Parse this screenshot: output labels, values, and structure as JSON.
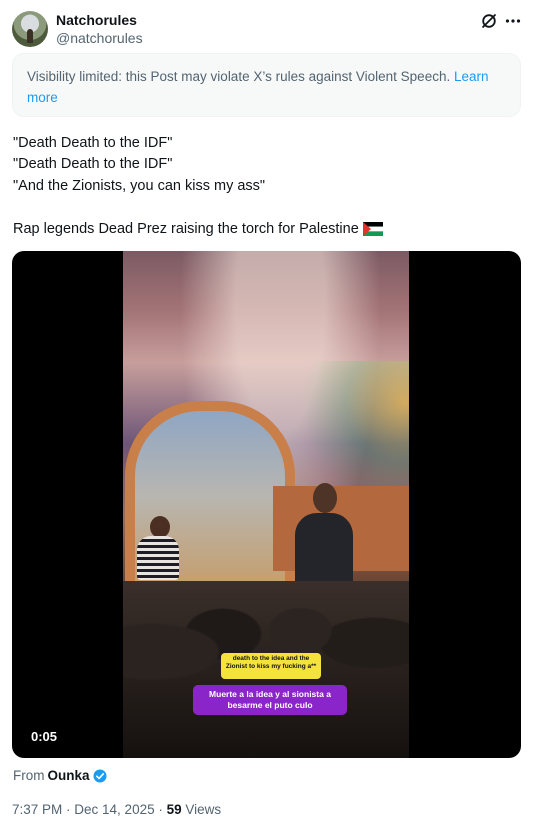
{
  "author": {
    "display_name": "Natchorules",
    "handle": "@natchorules"
  },
  "notice": {
    "text": "Visibility limited: this Post may violate X’s rules against Violent Speech. ",
    "link": "Learn more"
  },
  "post": {
    "lines": [
      "\"Death Death to the IDF\"",
      "\"Death Death to the IDF\"",
      "\"And the Zionists, you can kiss my ass\"",
      "Rap legends Dead Prez raising the torch for Palestine"
    ],
    "flag_icon": "palestine-flag-icon"
  },
  "video": {
    "time": "0:05",
    "caption_english": "death to the idea and the Zionist to kiss my fucking a**",
    "caption_spanish": "Muerte a la idea y al sionista a besarme el puto culo"
  },
  "source": {
    "prefix": "From",
    "name": "Ounka",
    "verified_color": "#1d9bf0"
  },
  "meta": {
    "time": "7:37 PM",
    "date": "Dec 14, 2025",
    "views_count": "59",
    "views_label": "Views"
  },
  "icons": {
    "grok": "grok-icon",
    "more": "more-icon"
  }
}
